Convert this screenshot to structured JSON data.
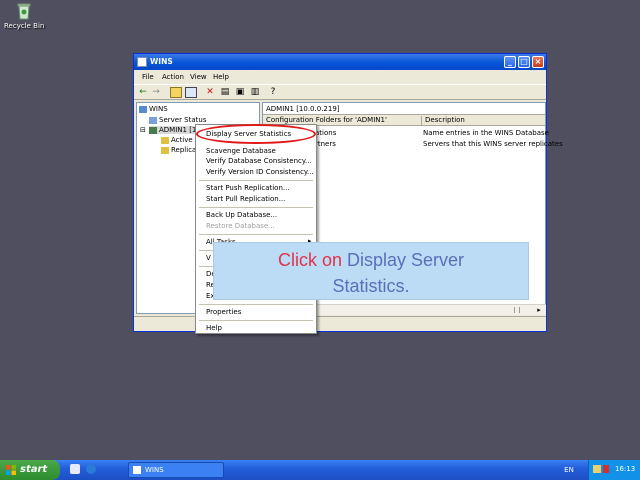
{
  "desktop": {
    "recycle_bin_label": "Recycle Bin"
  },
  "window": {
    "title": "WINS",
    "menu": [
      "File",
      "Action",
      "View",
      "Help"
    ],
    "tree": {
      "root": "WINS",
      "server_status": "Server Status",
      "server": "ADMIN1 [1",
      "active": "Active",
      "replica": "Replica"
    },
    "right_header": "ADMIN1 [10.0.0.219]",
    "columns": [
      "Configuration Folders for 'ADMIN1'",
      "Description"
    ],
    "rows": [
      {
        "name": "ations",
        "description": "Name entries in the WINS Database"
      },
      {
        "name": "rtners",
        "description": "Servers that this WINS server replicates"
      }
    ]
  },
  "context_menu": {
    "items": [
      "Display Server Statistics",
      "Scavenge Database",
      "Verify Database Consistency...",
      "Verify Version ID Consistency...",
      "Start Push Replication...",
      "Start Pull Replication...",
      "Back Up Database...",
      "Restore Database...",
      "All Tasks",
      "V",
      "De",
      "Re",
      "Ex",
      "Properties",
      "Help"
    ]
  },
  "callout": {
    "part1": "Click on",
    "part2": "Display Server",
    "part3": "Statistics.",
    "color_action": "#e0334a",
    "color_target": "#5b6fb8"
  },
  "taskbar": {
    "start_label": "start",
    "task_label": "WINS",
    "language": "EN",
    "clock": "16:13"
  }
}
